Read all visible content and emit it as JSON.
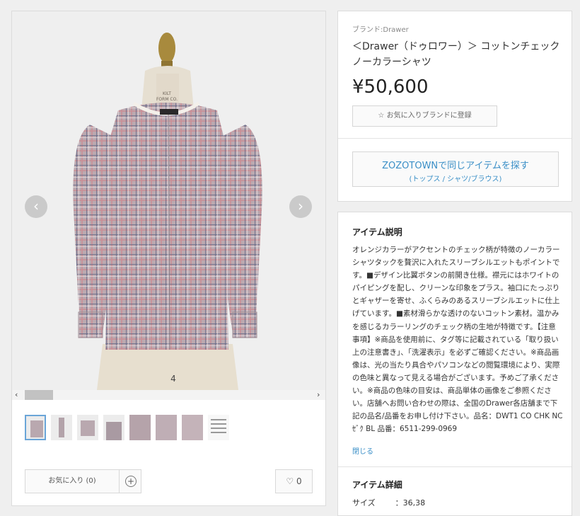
{
  "gallery": {
    "prev_icon": "‹",
    "next_icon": "›",
    "scroll_left": "‹",
    "scroll_right": "›",
    "mannequin_tag": "KILT\nFORM CO.",
    "mannequin_number": "4",
    "thumbnail_count": 8
  },
  "actions": {
    "favorite_label": "お気に入り (0)",
    "add_icon": "+",
    "like_icon": "♡",
    "like_count": "0"
  },
  "product": {
    "brand_label": "ブランド:Drawer",
    "title": "＜Drawer（ドゥロワー）＞ コットンチェックノーカラーシャツ",
    "price": "¥50,600",
    "fav_brand_button": "☆ お気に入りブランドに登録",
    "zozo_button_main": "ZOZOTOWNで同じアイテムを探す",
    "zozo_button_sub": "(トップス / シャツ/ブラウス)"
  },
  "description": {
    "heading": "アイテム説明",
    "body": "オレンジカラーがアクセントのチェック柄が特徴のノーカラーシャツタックを贅沢に入れたスリーブシルエットもポイントです。■デザイン比翼ボタンの前開き仕様。襟元にはホワイトのパイピングを配し、クリーンな印象をプラス。袖口にたっぷりとギャザーを寄せ、ふくらみのあるスリーブシルエットに仕上げています。■素材滑らかな透けのないコットン素材。温かみを感じるカラーリングのチェック柄の生地が特徴です。【注意事項】※商品を使用前に、タグ等に記載されている「取り扱い上の注意書き」、「洗濯表示」を必ずご確認ください。※商品画像は、光の当たり具合やパソコンなどの閲覧環境により、実際の色味と異なって見える場合がございます。予めご了承ください。※商品の色味の目安は、商品単体の画像をご参照ください。店舗へお問い合わせの際は、全国のDrawer各店舗まで下記の品名/品番をお申し付け下さい。品名：DWT1 CO CHK NC ｾﾞｸ BL 品番：6511-299-0969",
    "close_link": "閉じる"
  },
  "details": {
    "heading": "アイテム詳細",
    "size_label": "サイズ",
    "size_value": "：36,38"
  },
  "colors": {
    "link": "#3a8fc7",
    "check_base": "#b6a6ad",
    "check_pink": "#c9868f",
    "check_navy": "#5a6280"
  }
}
